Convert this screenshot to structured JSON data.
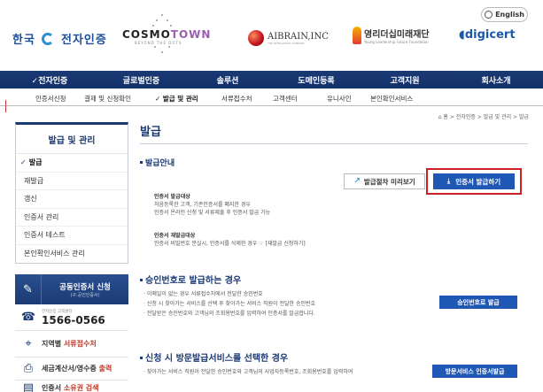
{
  "header": {
    "logo_main": "한국",
    "logo_main_b": "전자인증",
    "cosmo_a": "COSMO",
    "cosmo_b": "TOWN",
    "cosmo_tag": "BEYOND THE DOTS",
    "aibrain": "AIBRAIN,INC",
    "aibrain_tag": "THE INTELLIGENT COMPANY",
    "young": "영리더십미래재단",
    "young_tag": "Young Leadership Future Foundation",
    "digicert": "digicert",
    "lang_label": "English"
  },
  "gnb": [
    {
      "label": "✓전자인증",
      "active": true
    },
    {
      "label": "글로벌인증"
    },
    {
      "label": "솔루션"
    },
    {
      "label": "도메인등록"
    },
    {
      "label": "고객지원"
    },
    {
      "label": "회사소개"
    }
  ],
  "lnb": [
    {
      "label": "인증서신청"
    },
    {
      "label": "결제 및 신청확인"
    },
    {
      "label": "✓ 발급 및 관리",
      "active": true
    },
    {
      "label": "서류접수처"
    },
    {
      "label": "고객센터"
    },
    {
      "label": "유니사인"
    },
    {
      "label": "본인확인서비스"
    }
  ],
  "breadcrumb": "⌂ 홈 > 전자인증 > 발급 및 관리 > 발급",
  "sidebar": {
    "title": "발급 및 관리",
    "items": [
      {
        "label": "발급",
        "active": true
      },
      {
        "label": "재발급"
      },
      {
        "label": "갱신"
      },
      {
        "label": "인증서 관리"
      },
      {
        "label": "인증서 테스트"
      },
      {
        "label": "본인확인서비스 관리"
      }
    ],
    "apply_title": "공동인증서 신청",
    "apply_sub": "(구.공인인증서)",
    "phone_label": "전자인증 고객센터",
    "phone": "1566-0566",
    "branch_a": "지역별",
    "branch_b": "서류접수처",
    "tax_a": "세금계산서/영수증",
    "tax_b": "출력",
    "cert_a": "인증서",
    "cert_b": "소유권 검색"
  },
  "content": {
    "page_title": "발급",
    "sec1_title": "발급안내",
    "preview_btn": "발급절차 미리보기",
    "issue_btn": "인증서 발급하기",
    "target_title": "인증서 발급대상",
    "target_l1": "처음등록한 고객, 기존인증서를 폐지한 경우",
    "target_l2": "인증서 온라인 신청 및 서류제출 후 인증서 발급 가능",
    "reissue_title": "인증서 재발급대상",
    "reissue_l1": "인증서 비밀번호 분실시, 인증서를 삭제한 경우 ☞ [재발급 신청하기]",
    "sec2_title": "승인번호로 발급하는 경우",
    "sec2_b1": "이메일이 없는 경우 서류접수처에서 전달한 승인번호",
    "sec2_b2": "신청 시 찾아가는 서비스를 선택 후 찾아가는 서비스 직원이 전달한 승인번호",
    "sec2_b3": "전달받은 승인번호와 고객님의 조회용번호를 입력하여 인증서를 발급합니다.",
    "sec2_btn": "승인번호로 발급",
    "sec3_title": "신청 시 방문발급서비스를 선택한 경우",
    "sec3_b1": "찾아가는 서비스 직원이 전달한 승인번호와 고객님의 사업자등록번호, 조회용번호를 입력하여",
    "sec3_btn": "방문서비스 인증서발급"
  },
  "colors": {
    "nav": "#1b3a73",
    "accent_btn": "#1f57b5",
    "highlight": "#c91f25"
  }
}
